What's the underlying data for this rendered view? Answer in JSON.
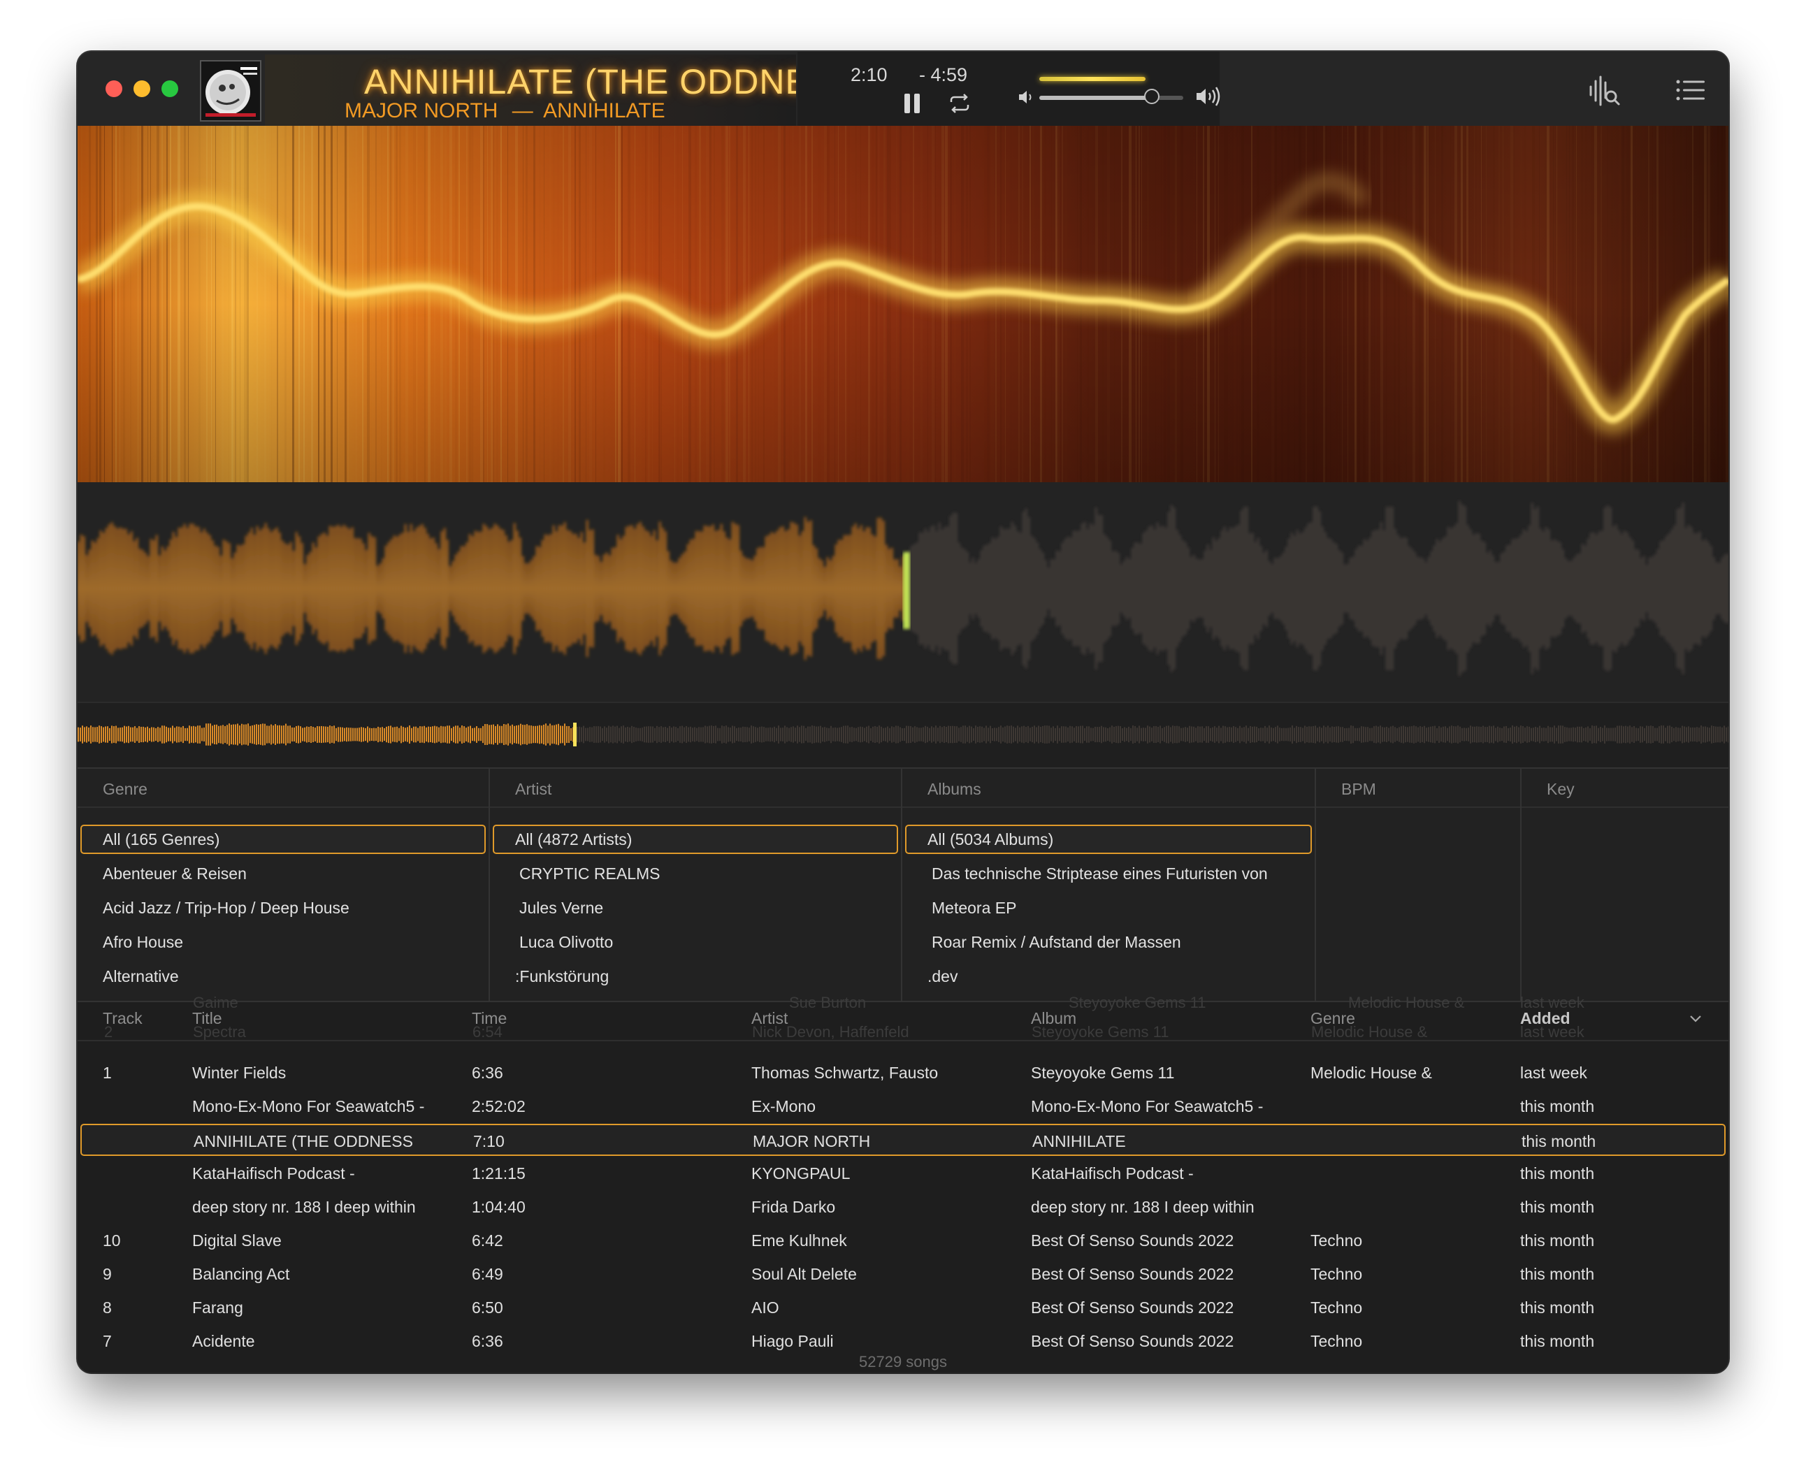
{
  "colors": {
    "accent": "#e09a2a",
    "title_glow": "#ffd36a",
    "subtitle": "#f29a24",
    "played_wave": "#e8902a",
    "unplayed_wave": "#4a423e"
  },
  "now_playing": {
    "title": "ANNIHILATE (THE ODDNE",
    "artist": "MAJOR NORTH",
    "separator": "—",
    "album": "ANNIHILATE",
    "elapsed": "2:10",
    "remaining": "- 4:59",
    "progress": 0.3,
    "volume": 0.78
  },
  "icons": [
    "close-light",
    "minimize-light",
    "zoom-light",
    "pause-icon",
    "repeat-icon",
    "volume-low-icon",
    "volume-high-icon",
    "visualizer-search-icon",
    "list-icon",
    "chevron-down-icon"
  ],
  "browser": {
    "genre": {
      "header": "Genre",
      "selected": "All (165 Genres)",
      "items": [
        "Abenteuer & Reisen",
        "Acid Jazz / Trip-Hop / Deep House",
        "Afro House",
        "Alternative"
      ]
    },
    "artist": {
      "header": "Artist",
      "selected": "All (4872 Artists)",
      "items": [
        "CRYPTIC REALMS",
        "Jules Verne",
        "Luca Olivotto",
        ":Funkstörung"
      ]
    },
    "albums": {
      "header": "Albums",
      "selected": "All (5034 Albums)",
      "items": [
        "Das technische Striptease eines Futuristen von",
        "Meteora EP",
        "Roar Remix /  Aufstand der Massen",
        ".dev"
      ]
    },
    "bpm": {
      "header": "BPM"
    },
    "key": {
      "header": "Key"
    }
  },
  "table": {
    "headers": {
      "track": "Track",
      "title": "Title",
      "time": "Time",
      "artist": "Artist",
      "album": "Album",
      "genre": "Genre",
      "added": "Added"
    },
    "ghost": {
      "track": "2",
      "title": "Spectra",
      "time": "6:54",
      "artist": "Nick Devon, Haffenfeld",
      "album": "Steyoyoke Gems 11",
      "genre": "Melodic House &",
      "added": "last week",
      "title_top": "Gaime",
      "artist_top": "Sue Burton",
      "album_top": "Steyoyoke Gems 11",
      "genre_top": "Melodic House &",
      "added_top": "last week"
    },
    "rows": [
      {
        "track": "1",
        "title": "Winter Fields",
        "time": "6:36",
        "artist": "Thomas Schwartz, Fausto",
        "album": "Steyoyoke Gems 11",
        "genre": "Melodic House &",
        "added": "last week"
      },
      {
        "track": "",
        "title": "Mono-Ex-Mono For Seawatch5 -",
        "time": "2:52:02",
        "artist": "Ex-Mono",
        "album": "Mono-Ex-Mono For Seawatch5 -",
        "genre": "",
        "added": "this month"
      },
      {
        "track": "",
        "title": "ANNIHILATE (THE ODDNESS",
        "time": "7:10",
        "artist": "MAJOR NORTH",
        "album": "ANNIHILATE",
        "genre": "",
        "added": "this month"
      },
      {
        "track": "",
        "title": "KataHaifisch Podcast -",
        "time": "1:21:15",
        "artist": "KYONGPAUL",
        "album": "KataHaifisch Podcast -",
        "genre": "",
        "added": "this month"
      },
      {
        "track": "",
        "title": "deep story nr. 188 I deep within",
        "time": "1:04:40",
        "artist": "Frida Darko",
        "album": "deep story nr. 188 I deep within",
        "genre": "",
        "added": "this month"
      },
      {
        "track": "10",
        "title": "Digital Slave",
        "time": "6:42",
        "artist": "Eme Kulhnek",
        "album": "Best Of Senso Sounds 2022",
        "genre": "Techno",
        "added": "this month"
      },
      {
        "track": "9",
        "title": "Balancing Act",
        "time": "6:49",
        "artist": "Soul Alt Delete",
        "album": "Best Of Senso Sounds 2022",
        "genre": "Techno",
        "added": "this month"
      },
      {
        "track": "8",
        "title": "Farang",
        "time": "6:50",
        "artist": "AIO",
        "album": "Best Of Senso Sounds 2022",
        "genre": "Techno",
        "added": "this month"
      },
      {
        "track": "7",
        "title": "Acidente",
        "time": "6:36",
        "artist": "Hiago Pauli",
        "album": "Best Of Senso Sounds 2022",
        "genre": "Techno",
        "added": "this month"
      }
    ],
    "selected_row": 2,
    "footer": "52729 songs"
  }
}
